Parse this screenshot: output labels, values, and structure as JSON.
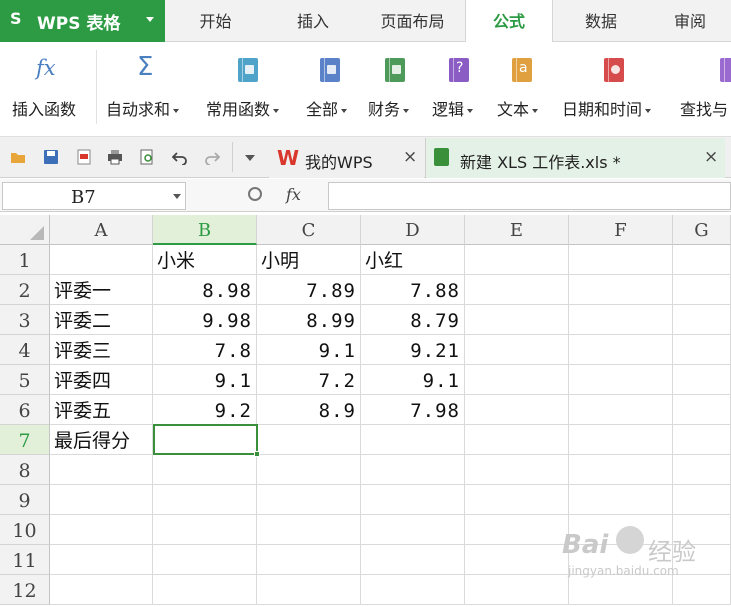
{
  "app": {
    "logo": "S",
    "title": "WPS 表格"
  },
  "ribbon_tabs": [
    "开始",
    "插入",
    "页面布局",
    "公式",
    "数据",
    "审阅"
  ],
  "active_tab": "公式",
  "ribbon": {
    "items": [
      {
        "label": "插入函数",
        "icon": "fx-icon",
        "dropdown": false
      },
      {
        "label": "自动求和",
        "icon": "sigma-icon",
        "dropdown": true
      },
      {
        "label": "常用函数",
        "icon": "star-book-icon",
        "dropdown": true
      },
      {
        "label": "全部",
        "icon": "list-book-icon",
        "dropdown": true
      },
      {
        "label": "财务",
        "icon": "finance-book-icon",
        "dropdown": true
      },
      {
        "label": "逻辑",
        "icon": "question-book-icon",
        "dropdown": true
      },
      {
        "label": "文本",
        "icon": "text-book-icon",
        "dropdown": true
      },
      {
        "label": "日期和时间",
        "icon": "clock-book-icon",
        "dropdown": true
      },
      {
        "label": "查找与",
        "icon": "lookup-book-icon",
        "dropdown": false
      }
    ],
    "fx_glyph": "fx",
    "sigma_glyph": "Σ",
    "text_book_glyph": "a",
    "question_book_glyph": "?"
  },
  "quick_access": [
    "open-folder-icon",
    "save-icon",
    "export-pdf-icon",
    "print-icon",
    "print-preview-icon",
    "undo-icon",
    "redo-icon",
    "customize-dropdown-icon"
  ],
  "doc_tabs": [
    {
      "label": "我的WPS",
      "close": "×"
    },
    {
      "label": "新建 XLS 工作表.xls *",
      "close": "×"
    }
  ],
  "formula_bar": {
    "cell_ref": "B7",
    "fx_label": "fx",
    "value": ""
  },
  "sheet": {
    "columns": [
      "A",
      "B",
      "C",
      "D",
      "E",
      "F",
      "G"
    ],
    "rows": [
      "1",
      "2",
      "3",
      "4",
      "5",
      "6",
      "7",
      "8",
      "9",
      "10",
      "11",
      "12"
    ],
    "selected_col": "B",
    "selected_row": "7",
    "cells": [
      [
        "",
        "小米",
        "小明",
        "小红",
        "",
        "",
        ""
      ],
      [
        "评委一",
        "8.98",
        "7.89",
        "7.88",
        "",
        "",
        ""
      ],
      [
        "评委二",
        "9.98",
        "8.99",
        "8.79",
        "",
        "",
        ""
      ],
      [
        "评委三",
        "7.8",
        "9.1",
        "9.21",
        "",
        "",
        ""
      ],
      [
        "评委四",
        "9.1",
        "7.2",
        "9.1",
        "",
        "",
        ""
      ],
      [
        "评委五",
        "9.2",
        "8.9",
        "7.98",
        "",
        "",
        ""
      ],
      [
        "最后得分",
        "",
        "",
        "",
        "",
        "",
        ""
      ]
    ]
  },
  "colors": {
    "accent": "#2d9b44",
    "selection": "#3a8f3a"
  },
  "watermark": {
    "brand": "Bai",
    "suffix": "经验",
    "url": "jingyan.baidu.com"
  }
}
